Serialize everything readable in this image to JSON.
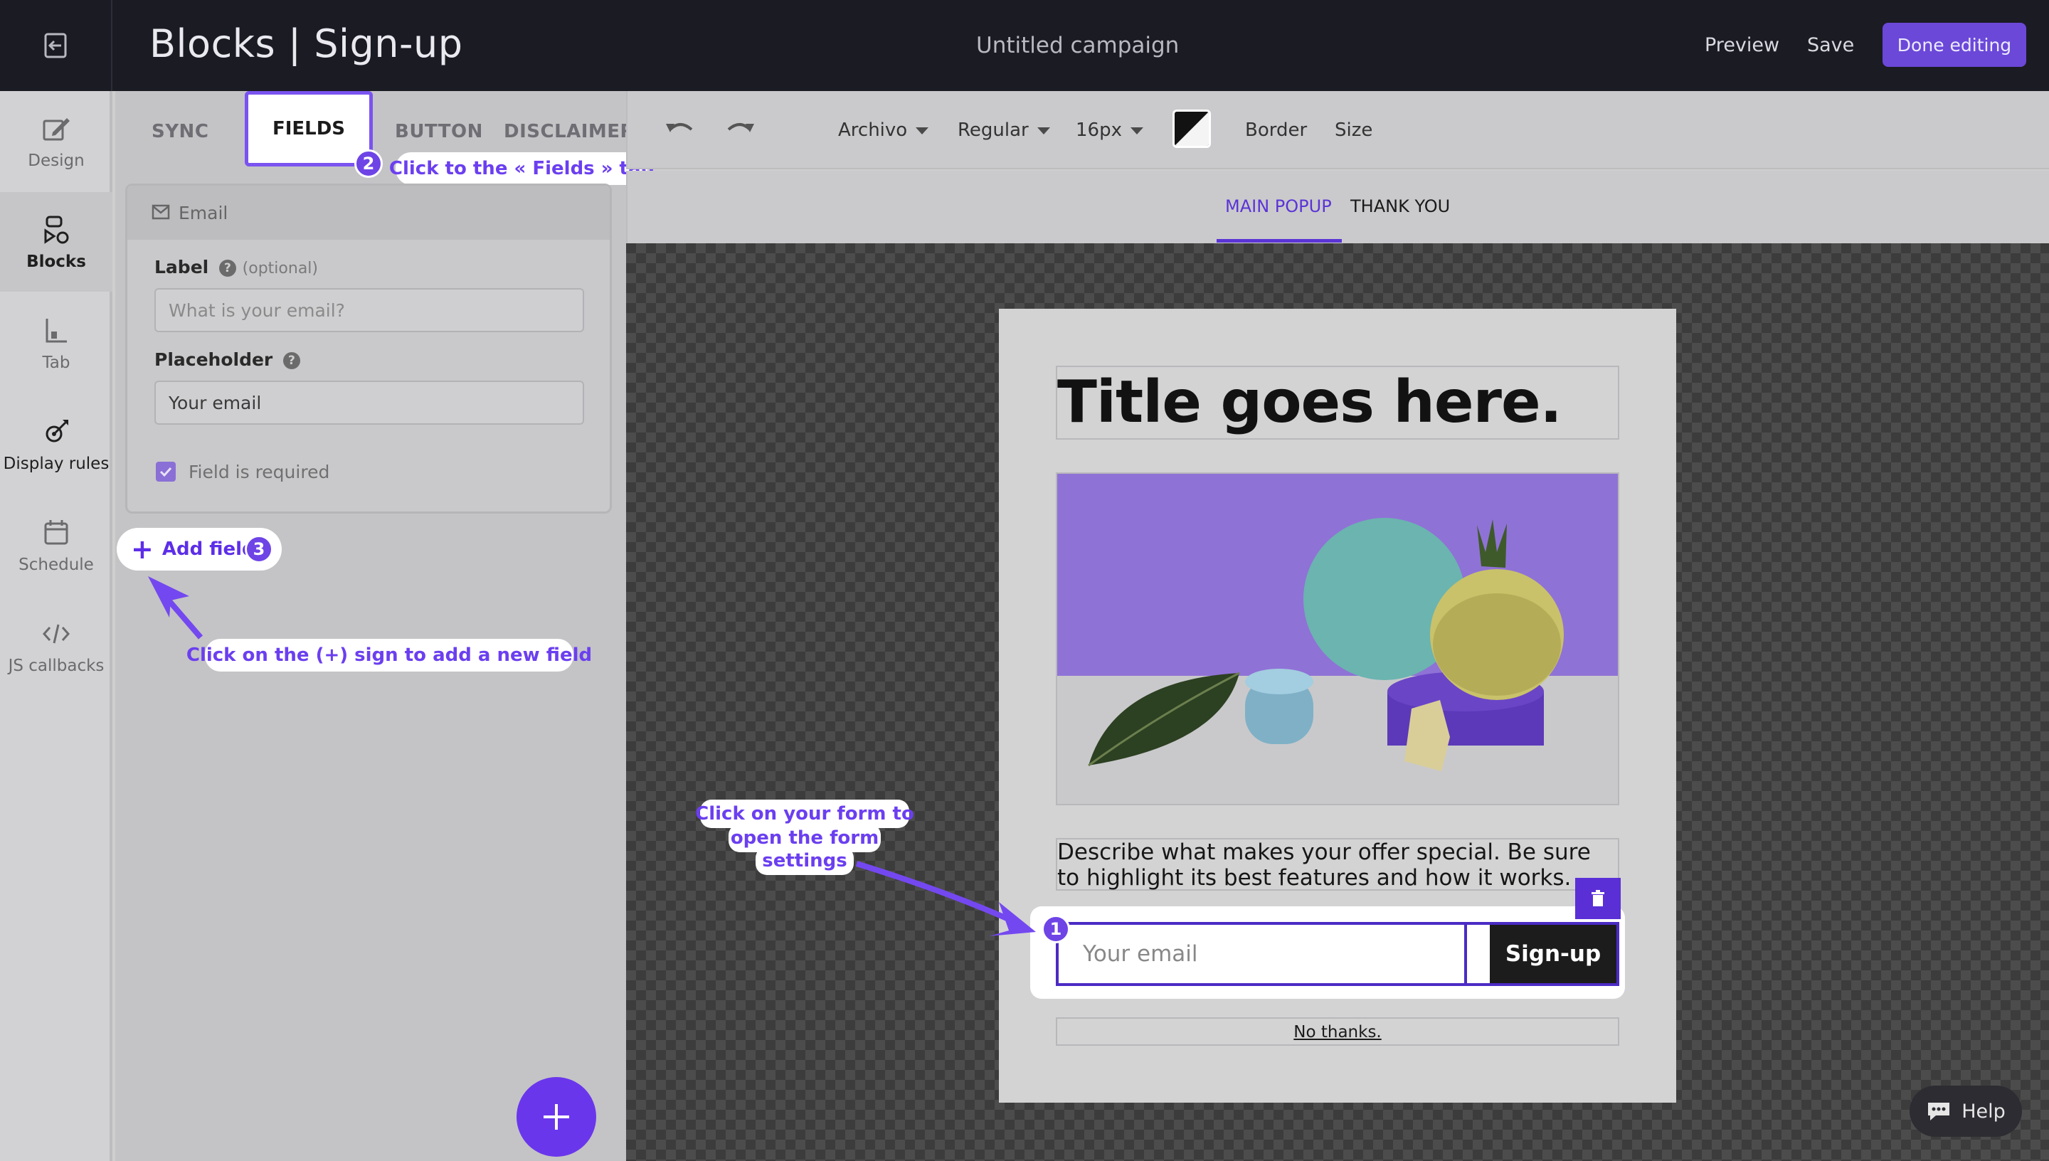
{
  "header": {
    "title": "Blocks | Sign-up",
    "campaign": "Untitled campaign",
    "preview": "Preview",
    "save": "Save",
    "done": "Done editing"
  },
  "rail": {
    "items": [
      {
        "label": "Design",
        "icon": "pencil-square-icon"
      },
      {
        "label": "Blocks",
        "icon": "shapes-icon"
      },
      {
        "label": "Tab",
        "icon": "tab-icon"
      },
      {
        "label": "Display rules",
        "icon": "target-icon"
      },
      {
        "label": "Schedule",
        "icon": "calendar-icon"
      },
      {
        "label": "JS callbacks",
        "icon": "code-icon"
      }
    ]
  },
  "panel": {
    "tabs": [
      "SYNC",
      "FIELDS",
      "BUTTON",
      "DISCLAIMER"
    ],
    "field_card": {
      "title": "Email",
      "label_label": "Label",
      "label_optional": "(optional)",
      "label_placeholder": "What is your email?",
      "placeholder_label": "Placeholder",
      "placeholder_value": "Your email",
      "required_label": "Field is required",
      "required_checked": true
    },
    "add_field": "Add field"
  },
  "toolbar": {
    "font": "Archivo",
    "weight": "Regular",
    "size": "16px",
    "border": "Border",
    "size_label": "Size",
    "text_color": "#121212"
  },
  "subtabs": [
    "MAIN POPUP",
    "THANK YOU"
  ],
  "popup": {
    "title": "Title goes here.",
    "description": "Describe what makes your offer special. Be sure to highlight its best features and how it works.",
    "email_placeholder": "Your email",
    "submit": "Sign-up",
    "no_thanks": "No thanks."
  },
  "annotations": {
    "step1": {
      "number": "1",
      "text_lines": [
        "Click on your form to",
        "open the form",
        "settings"
      ]
    },
    "step2": {
      "number": "2",
      "text": "Click to the « Fields » tab"
    },
    "step3": {
      "number": "3",
      "text": "Click on the (+) sign to add a new field"
    }
  },
  "help": "Help",
  "colors": {
    "accent": "#6b48d8",
    "topbar": "#1b1b24",
    "annotation": "#6b3ff0"
  }
}
